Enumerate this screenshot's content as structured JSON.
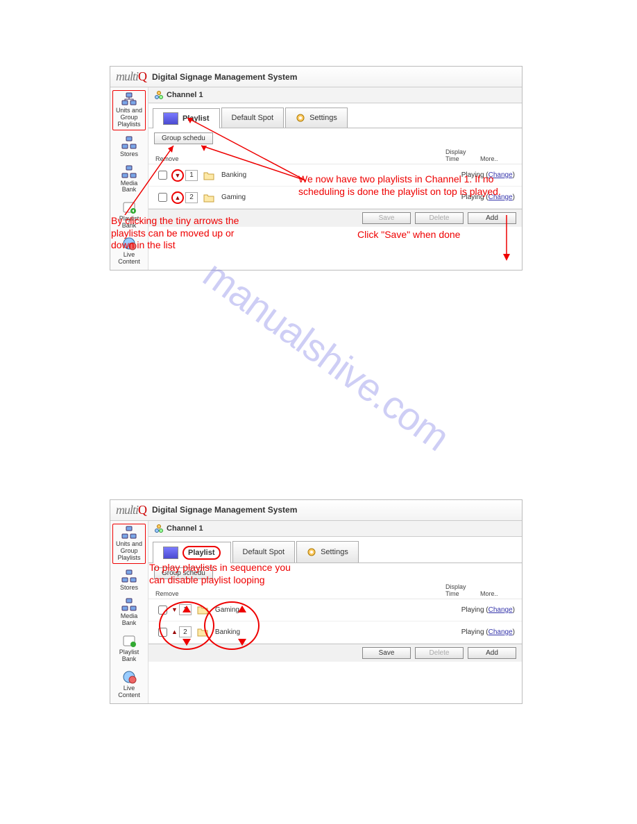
{
  "app": {
    "logo_text": "multi",
    "logo_accent": "Q",
    "title": "Digital Signage Management System"
  },
  "sidebar": {
    "items": [
      {
        "label": "Units and Group Playlists"
      },
      {
        "label": "Stores"
      },
      {
        "label": "Media Bank"
      },
      {
        "label": "Playlist Bank"
      },
      {
        "label": "Live Content"
      }
    ]
  },
  "channel": {
    "title": "Channel 1"
  },
  "tabs": {
    "playlist": "Playlist",
    "default_spot": "Default Spot",
    "settings": "Settings"
  },
  "subbar": {
    "group_schedule": "Group schedu"
  },
  "list_header": {
    "remove": "Remove",
    "display_time": "Display Time",
    "more": "More.."
  },
  "screenshot1": {
    "rows": [
      {
        "order": "1",
        "name": "Banking",
        "status": "Playing",
        "change": "Change"
      },
      {
        "order": "2",
        "name": "Gaming",
        "status": "Playing",
        "change": "Change"
      }
    ],
    "buttons": {
      "save": "Save",
      "delete": "Delete",
      "add": "Add"
    }
  },
  "screenshot2": {
    "rows": [
      {
        "order": "1",
        "name": "Gaming",
        "status": "Playing",
        "change": "Change"
      },
      {
        "order": "2",
        "name": "Banking",
        "status": "Playing",
        "change": "Change"
      }
    ],
    "buttons": {
      "save": "Save",
      "delete": "Delete",
      "add": "Add"
    }
  },
  "annotations": {
    "two_playlists": "We now have two playlists in Channel 1. If no scheduling is done the playlist on top is played.",
    "tiny_arrows": "By clicking the tiny arrows the playlists can be moved up or down in the list",
    "click_save": "Click \"Save\" when done",
    "sequence": "To play playlists in sequence you can disable playlist looping"
  },
  "watermark": "manualshive.com"
}
